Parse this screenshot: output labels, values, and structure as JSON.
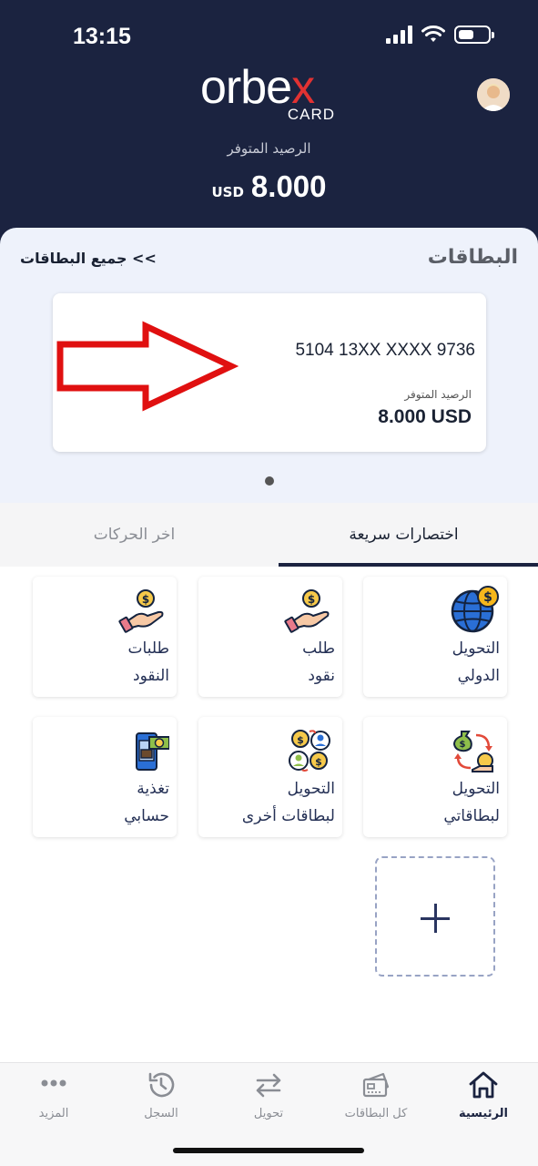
{
  "status": {
    "time": "13:15"
  },
  "header": {
    "logo_main": "orbe",
    "logo_x": "x",
    "logo_sub": "CARD",
    "balance_label": "الرصيد المتوفر",
    "balance_currency": "USD",
    "balance_amount": "8.000"
  },
  "cards": {
    "title": "البطاقات",
    "all_cards_link": "جميع البطاقات <<",
    "card": {
      "number": "5104 13XX XXXX 9736",
      "balance_label": "الرصيد المتوفر",
      "balance": "8.000 USD"
    }
  },
  "tabs": {
    "quick": "اختصارات سريعة",
    "recent": "اخر الحركات"
  },
  "shortcuts": [
    {
      "label": "التحويل\nالدولي",
      "icon": "globe-dollar-icon"
    },
    {
      "label": "طلب\nنقود",
      "icon": "hand-coin-icon"
    },
    {
      "label": "طلبات\nالنقود",
      "icon": "hand-coin-icon"
    },
    {
      "label": "التحويل\nلبطاقاتي",
      "icon": "money-bag-transfer-icon"
    },
    {
      "label": "التحويل\nلبطاقات أخرى",
      "icon": "people-transfer-icon"
    },
    {
      "label": "تغذية\nحسابي",
      "icon": "wallet-topup-icon"
    }
  ],
  "bottom_nav": {
    "home": "الرئيسية",
    "all_cards": "كل البطاقات",
    "transfer": "تحويل",
    "history": "السجل",
    "more": "المزيد"
  },
  "colors": {
    "header_bg": "#1b2340",
    "accent_red": "#e23232",
    "section_bg": "#eef2fb"
  }
}
